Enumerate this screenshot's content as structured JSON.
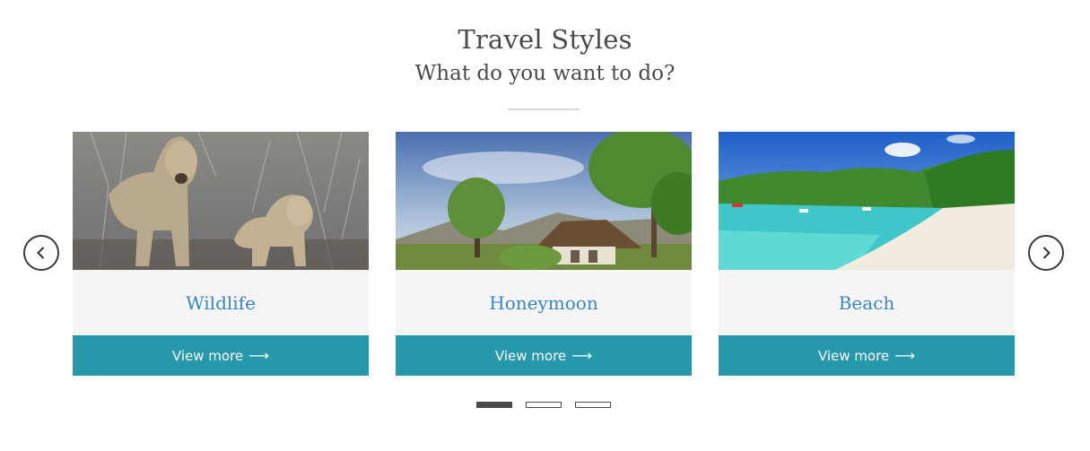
{
  "section": {
    "title": "Travel Styles",
    "subtitle": "What do you want to do?"
  },
  "carousel": {
    "prev_icon": "chevron-left-icon",
    "next_icon": "chevron-right-icon",
    "cards": [
      {
        "title": "Wildlife",
        "button_label": "View more",
        "button_icon": "arrow-right-icon",
        "image": "lioness-and-cub-photo"
      },
      {
        "title": "Honeymoon",
        "button_label": "View more",
        "button_icon": "arrow-right-icon",
        "image": "thatched-lodge-photo"
      },
      {
        "title": "Beach",
        "button_label": "View more",
        "button_icon": "arrow-right-icon",
        "image": "tropical-beach-photo"
      }
    ],
    "pagination": {
      "pages": 3,
      "active": 1
    }
  },
  "colors": {
    "accent": "#2698ab",
    "link": "#3a85c3",
    "heading": "#4a4a4a",
    "card_bg": "#f5f5f5"
  }
}
